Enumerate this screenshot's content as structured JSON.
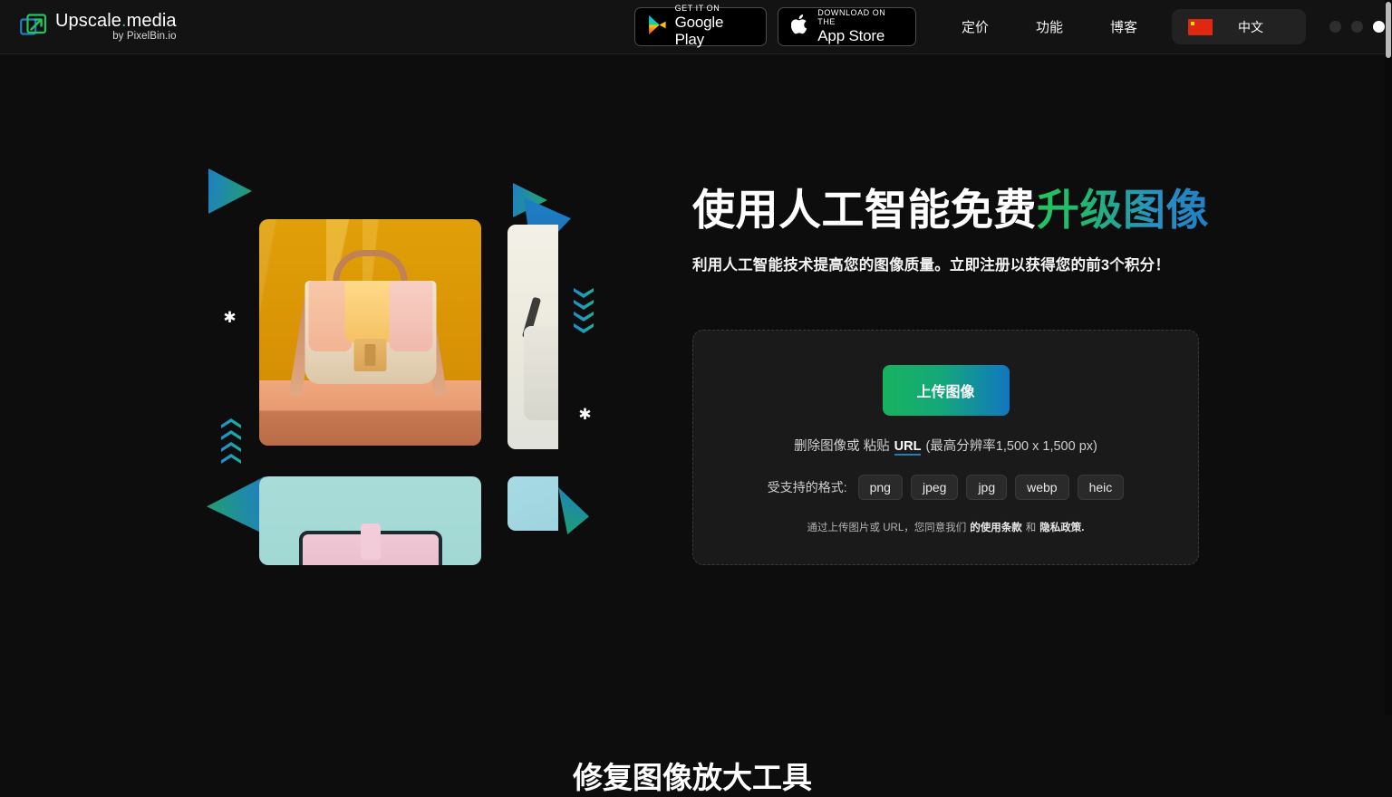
{
  "header": {
    "brand": {
      "logo_icon": "upscale-arrow-logo",
      "title_main": "Upscale",
      "title_dot": ".",
      "title_suffix": "media",
      "subtitle": "by PixelBin.io"
    },
    "store_buttons": [
      {
        "icon": "google-play-icon",
        "small": "GET IT ON",
        "big": "Google Play"
      },
      {
        "icon": "apple-icon",
        "small": "Download on the",
        "big": "App Store"
      }
    ],
    "nav_links": [
      {
        "label": "定价"
      },
      {
        "label": "功能"
      },
      {
        "label": "博客"
      }
    ],
    "language": {
      "flag_icon": "china-flag-icon",
      "label": "中文"
    },
    "indicator_dots": 3,
    "indicator_active_index": 2
  },
  "hero": {
    "headline_plain": "使用人工智能免费",
    "headline_accent": "升级图像",
    "subheadline": "利用人工智能技术提高您的图像质量。立即注册以获得您的前3个积分！",
    "collage": {
      "alt": "handbag upscale comparison collage",
      "decorations": [
        "triangle-icon",
        "chevron-down-icon",
        "chevron-up-icon",
        "sparkle-icon"
      ]
    },
    "upload": {
      "button_label": "上传图像",
      "drop_prefix": "删除图像或 粘贴",
      "drop_link": "URL",
      "drop_suffix": "(最高分辨率1,500 x 1,500 px)",
      "formats_label": "受支持的格式:",
      "formats": [
        "png",
        "jpeg",
        "jpg",
        "webp",
        "heic"
      ],
      "terms_prefix": "通过上传图片或 URL，您同意我们",
      "terms_link_1": "的使用条款",
      "terms_and": "和",
      "terms_link_2": "隐私政策."
    }
  },
  "next_section": {
    "heading": "修复图像放大工具"
  },
  "colors": {
    "page_bg": "#0d0d0d",
    "header_bg": "#131313",
    "accent_green": "#22c55e",
    "accent_blue": "#1f7fc4",
    "card_bg": "#1a1a1a",
    "flag_red": "#de2910"
  }
}
